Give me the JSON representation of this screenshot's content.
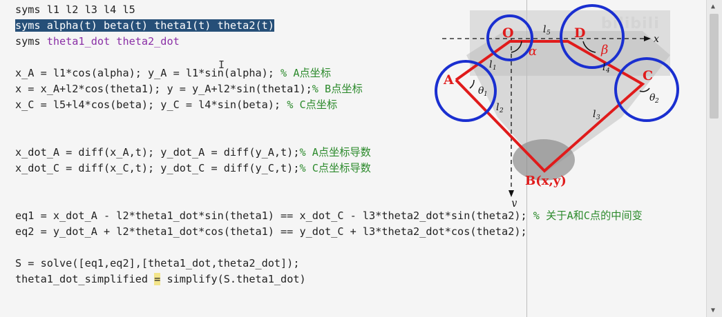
{
  "lines": [
    {
      "parts": [
        {
          "t": "syms l1 l2 l3 l4 l5",
          "c": "kw"
        }
      ]
    },
    {
      "parts": [
        {
          "t": "syms alpha(t) beta(t) theta1(t) theta2(t)",
          "c": "sel"
        }
      ]
    },
    {
      "parts": [
        {
          "t": "syms ",
          "c": "kw"
        },
        {
          "t": "theta1_dot theta2_dot",
          "c": "var"
        }
      ]
    },
    {
      "parts": []
    },
    {
      "parts": [
        {
          "t": "x_A = l1*cos(alpha); y_A = l1*sin(alpha); ",
          "c": "kw"
        },
        {
          "t": "% A点坐标",
          "c": "cm"
        }
      ]
    },
    {
      "parts": [
        {
          "t": "x = x_A+l2*cos(theta1); y = y_A+l2*sin(theta1);",
          "c": "kw"
        },
        {
          "t": "% B点坐标",
          "c": "cm"
        }
      ]
    },
    {
      "parts": [
        {
          "t": "x_C = l5+l4*cos(beta); y_C = l4*sin(beta); ",
          "c": "kw"
        },
        {
          "t": "% C点坐标",
          "c": "cm"
        }
      ]
    },
    {
      "parts": []
    },
    {
      "parts": []
    },
    {
      "parts": [
        {
          "t": "x_dot_A = diff(x_A,t); y_dot_A = diff(y_A,t);",
          "c": "kw"
        },
        {
          "t": "% A点坐标导数",
          "c": "cm"
        }
      ]
    },
    {
      "parts": [
        {
          "t": "x_dot_C = diff(x_C,t); y_dot_C = diff(y_C,t);",
          "c": "kw"
        },
        {
          "t": "% C点坐标导数",
          "c": "cm"
        }
      ]
    },
    {
      "parts": []
    },
    {
      "parts": []
    },
    {
      "parts": [
        {
          "t": "eq1 = x_dot_A - l2*theta1_dot*sin(theta1) == x_dot_C - l3*theta2_dot*sin(theta2); ",
          "c": "kw"
        },
        {
          "t": "% 关于A和C点的中间变",
          "c": "cm"
        }
      ]
    },
    {
      "parts": [
        {
          "t": "eq2 = y_dot_A + l2*theta1_dot*cos(theta1) == y_dot_C + l3*theta2_dot*cos(theta2);",
          "c": "kw"
        }
      ]
    },
    {
      "parts": []
    },
    {
      "parts": [
        {
          "t": "S = solve([eq1,eq2],[theta1_dot,theta2_dot]);",
          "c": "kw"
        }
      ]
    },
    {
      "parts": [
        {
          "t": "theta1_dot_simplified ",
          "c": "kw"
        },
        {
          "t": "=",
          "c": "hl"
        },
        {
          "t": " simplify(S.theta1_dot)",
          "c": "kw"
        }
      ]
    }
  ],
  "diagram": {
    "labels": {
      "O": "O",
      "D": "D",
      "A": "A",
      "C": "C",
      "B": "B(x,y)",
      "x_axis": "x",
      "y_axis": "y",
      "l1": "l",
      "l1_sub": "1",
      "l2": "l",
      "l2_sub": "2",
      "l3": "l",
      "l3_sub": "3",
      "l4": "l",
      "l4_sub": "4",
      "l5": "l",
      "l5_sub": "5",
      "alpha": "α",
      "beta": "β",
      "theta1": "θ",
      "theta1_sub": "1",
      "theta2": "θ",
      "theta2_sub": "2"
    }
  },
  "watermark": "bilibili",
  "colors": {
    "selection": "#264f78",
    "variable": "#8a2fa6",
    "comment": "#2c8a2c",
    "link": "#e01b1b",
    "circle": "#1a2fd0"
  }
}
